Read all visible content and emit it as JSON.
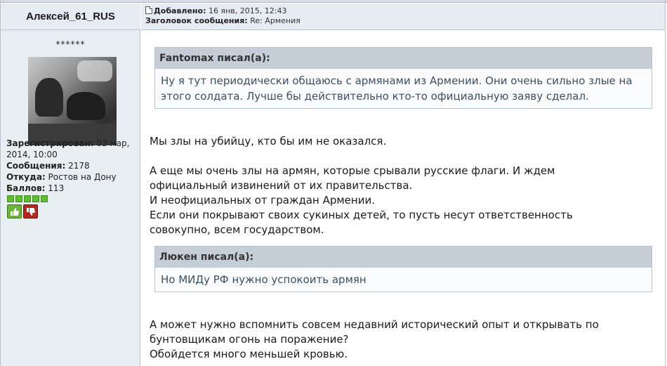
{
  "author": {
    "name": "Алексей_61_RUS",
    "rank": "******",
    "registered_label": "Зарегистрирован:",
    "registered_value": "03 мар, 2014, 10:00",
    "posts_label": "Сообщения:",
    "posts_value": "2178",
    "from_label": "Откуда:",
    "from_value": "Ростов на Дону",
    "points_label": "Баллов:",
    "points_value": "113",
    "reputation_level": 5
  },
  "post": {
    "added_label": "Добавлено:",
    "added_value": "16 янв, 2015, 12:43",
    "subject_label": "Заголовок сообщения:",
    "subject_value": "Re: Армения"
  },
  "quotes": [
    {
      "header": "Fantomax писал(а):",
      "text": "Ну я тут периодически общаюсь с армянами из Армении. Они очень сильно злые на этого солдата. Лучше бы действительно кто-то официальную заяву сделал."
    },
    {
      "header": "Люкен писал(а):",
      "text": "Но МИДу РФ нужно успокоить армян"
    }
  ],
  "paragraphs": {
    "p1": "Мы злы на убийцу, кто бы им не оказался.",
    "p2_l1": "А еще мы очень злы на армян, которые срывали русские флаги. И ждем",
    "p2_l2": "официальный извинений от их правительства.",
    "p2_l3": "И неофициальных от граждан Армении.",
    "p2_l4": "Если они покрывают своих сукиных детей, то пусть несут ответственность",
    "p2_l5": "совокупно, всем государством.",
    "p3_l1": "А может нужно вспомнить совсем недавний исторический опыт и открывать по",
    "p3_l2": "бунтовщикам огонь на поражение?",
    "p3_l3": "Обойдется много меньшей кровью."
  },
  "colors": {
    "header_bg": "#e6ecf1",
    "quote_header_bg": "#c5ced6",
    "rep_green": "#5fbf2e",
    "vote_up": "#6bb53b",
    "vote_down": "#b3281f"
  },
  "icons": {
    "post": "document-icon",
    "vote_up": "thumbs-up-icon",
    "vote_down": "thumbs-down-icon"
  }
}
